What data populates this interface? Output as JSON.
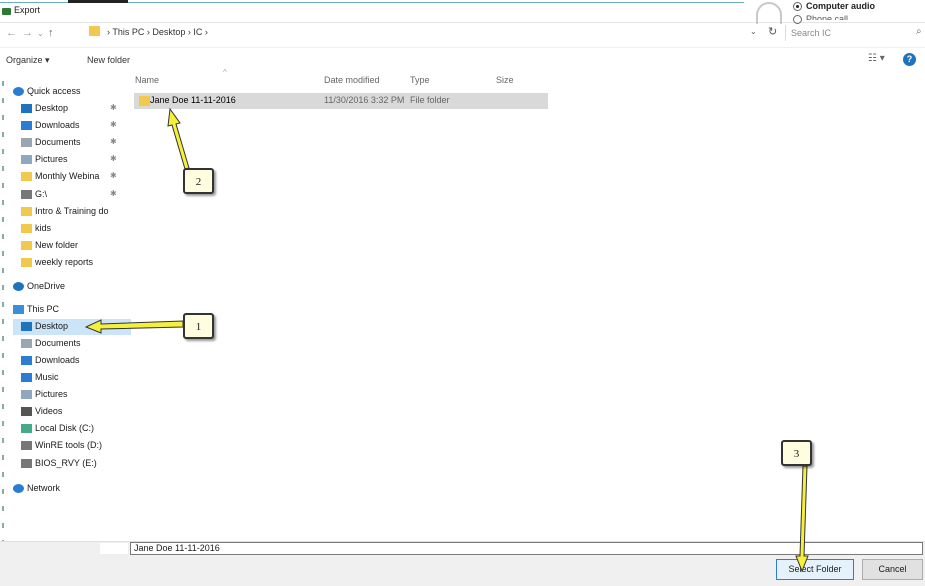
{
  "window": {
    "title": "Export"
  },
  "audio_panel": {
    "option1": "Computer audio",
    "option2": "Phone call"
  },
  "address": {
    "breadcrumb": "›  This PC  ›  Desktop  ›  IC  ›",
    "search_placeholder": "Search IC"
  },
  "toolbar": {
    "organize": "Organize ▾",
    "new_folder": "New folder"
  },
  "nav": {
    "items": [
      {
        "label": "Quick access",
        "icon": "star-icon"
      },
      {
        "label": "Desktop",
        "icon": "desktop-icon",
        "pinned": true
      },
      {
        "label": "Downloads",
        "icon": "download-icon",
        "pinned": true
      },
      {
        "label": "Documents",
        "icon": "document-icon",
        "pinned": true
      },
      {
        "label": "Pictures",
        "icon": "pictures-icon",
        "pinned": true
      },
      {
        "label": "Monthly Webina",
        "icon": "folder-icon",
        "pinned": true
      },
      {
        "label": "G:\\",
        "icon": "drive-icon",
        "pinned": true
      },
      {
        "label": "Intro  & Training do",
        "icon": "folder-icon"
      },
      {
        "label": "kids",
        "icon": "folder-icon"
      },
      {
        "label": "New folder",
        "icon": "folder-icon"
      },
      {
        "label": "weekly reports",
        "icon": "folder-icon"
      },
      {
        "label": "OneDrive",
        "icon": "cloud-icon"
      },
      {
        "label": "This PC",
        "icon": "computer-icon"
      },
      {
        "label": "Desktop",
        "icon": "desktop-icon",
        "selected": true
      },
      {
        "label": "Documents",
        "icon": "document-icon"
      },
      {
        "label": "Downloads",
        "icon": "download-icon"
      },
      {
        "label": "Music",
        "icon": "music-icon"
      },
      {
        "label": "Pictures",
        "icon": "pictures-icon"
      },
      {
        "label": "Videos",
        "icon": "video-icon"
      },
      {
        "label": "Local Disk (C:)",
        "icon": "disk-icon"
      },
      {
        "label": "WinRE tools (D:)",
        "icon": "drive-icon"
      },
      {
        "label": "BIOS_RVY (E:)",
        "icon": "drive-icon"
      },
      {
        "label": "Network",
        "icon": "network-icon"
      }
    ]
  },
  "columns": {
    "name": "Name",
    "date": "Date modified",
    "type": "Type",
    "size": "Size"
  },
  "files": [
    {
      "name": "Jane Doe 11-11-2016",
      "date": "11/30/2016 3:32 PM",
      "type": "File folder"
    }
  ],
  "footer": {
    "folder_value": "Jane Doe 11-11-2016",
    "select_button": "Select Folder",
    "cancel_button": "Cancel"
  },
  "annotations": {
    "step1": "1",
    "step2": "2",
    "step3": "3"
  },
  "colors": {
    "accent": "#1e73be",
    "selection": "#cce4f7",
    "arrow": "#f5f03a"
  }
}
